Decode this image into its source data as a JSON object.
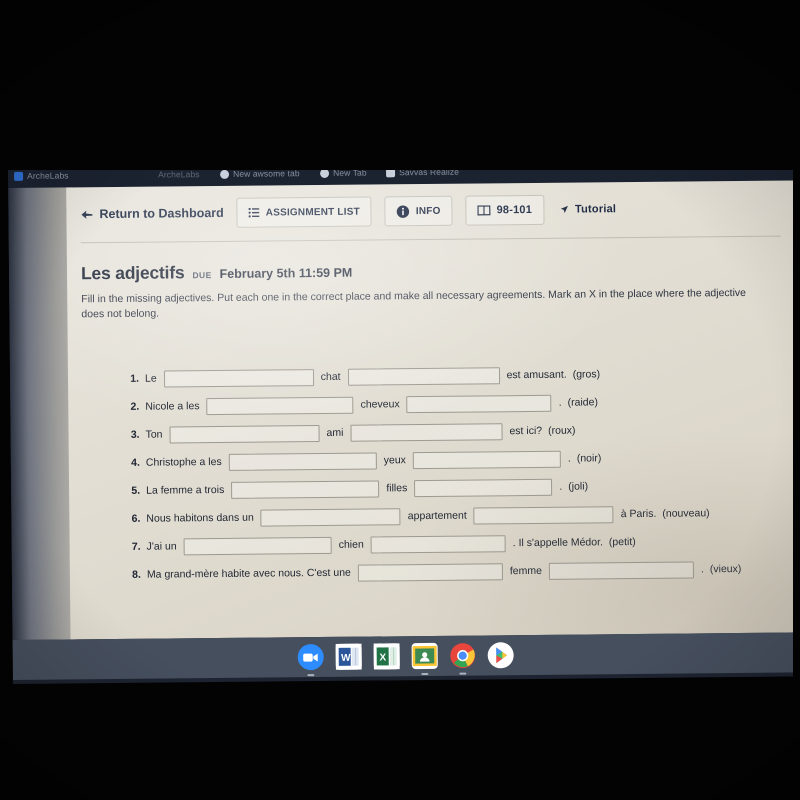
{
  "browser": {
    "tabs": [
      {
        "label": "ArcheLabs",
        "icon": "puzzle-icon"
      },
      {
        "label": "New awsome tab",
        "icon": "globe-icon"
      },
      {
        "label": "New Tab",
        "icon": "globe-icon"
      },
      {
        "label": "Savvas Realize",
        "icon": "savvas-icon"
      }
    ]
  },
  "toolbar": {
    "return_label": "Return to Dashboard",
    "return_icon": "back-arrow-icon",
    "assignment_list_label": "ASSIGNMENT LIST",
    "assignment_list_icon": "list-icon",
    "info_label": "INFO",
    "info_icon": "info-circle-icon",
    "pages_label": "98-101",
    "pages_icon": "book-icon",
    "tutorial_label": "Tutorial",
    "tutorial_icon": "cursor-arrow-icon"
  },
  "assignment": {
    "title": "Les adjectifs",
    "due_label": "DUE",
    "due_date": "February 5th 11:59 PM",
    "instructions": "Fill in the missing adjectives. Put each one in the correct place and make all necessary agreements. Mark an X in the place where the adjective does not belong."
  },
  "questions": [
    {
      "number": "1.",
      "pre": "Le",
      "blank1_value": "",
      "mid": "chat",
      "blank2_value": "",
      "post": "est amusant.",
      "hint": "(gros)",
      "blank1_width": 150,
      "blank2_width": 152
    },
    {
      "number": "2.",
      "pre": "Nicole a les",
      "blank1_value": "",
      "mid": "cheveux",
      "blank2_value": "",
      "post": ".",
      "hint": "(raide)",
      "blank1_width": 147,
      "blank2_width": 145
    },
    {
      "number": "3.",
      "pre": "Ton",
      "blank1_value": "",
      "mid": "ami",
      "blank2_value": "",
      "post": "est ici?",
      "hint": "(roux)",
      "blank1_width": 150,
      "blank2_width": 152
    },
    {
      "number": "4.",
      "pre": "Christophe a les",
      "blank1_value": "",
      "mid": "yeux",
      "blank2_value": "",
      "post": ".",
      "hint": "(noir)",
      "blank1_width": 148,
      "blank2_width": 148
    },
    {
      "number": "5.",
      "pre": "La femme a trois",
      "blank1_value": "",
      "mid": "filles",
      "blank2_value": "",
      "post": ".",
      "hint": "(joli)",
      "blank1_width": 148,
      "blank2_width": 138
    },
    {
      "number": "6.",
      "pre": "Nous habitons dans un",
      "blank1_value": "",
      "mid": "appartement",
      "blank2_value": "",
      "post": "à Paris.",
      "hint": "(nouveau)",
      "blank1_width": 140,
      "blank2_width": 140
    },
    {
      "number": "7.",
      "pre": "J'ai un",
      "blank1_value": "",
      "mid": "chien",
      "blank2_value": "",
      "post": ". Il s'appelle Médor.",
      "hint": "(petit)",
      "blank1_width": 148,
      "blank2_width": 135
    },
    {
      "number": "8.",
      "pre": "Ma grand-mère habite avec nous. C'est une",
      "blank1_value": "",
      "mid": "femme",
      "blank2_value": "",
      "post": ".",
      "hint": "(vieux)",
      "blank1_width": 145,
      "blank2_width": 145
    }
  ],
  "shelf": {
    "icons": [
      {
        "name": "zoom-icon",
        "glyph": "zoom"
      },
      {
        "name": "word-icon",
        "glyph": "W"
      },
      {
        "name": "excel-icon",
        "glyph": "X"
      },
      {
        "name": "google-classroom-icon",
        "glyph": "classroom"
      },
      {
        "name": "chrome-icon",
        "glyph": "chrome"
      },
      {
        "name": "play-store-icon",
        "glyph": "play"
      }
    ]
  },
  "colors": {
    "nav_text": "#1f2b44",
    "page_bg": "#e3dfd5",
    "shelf_bg": "#464f5e",
    "bezel": "#030303"
  }
}
